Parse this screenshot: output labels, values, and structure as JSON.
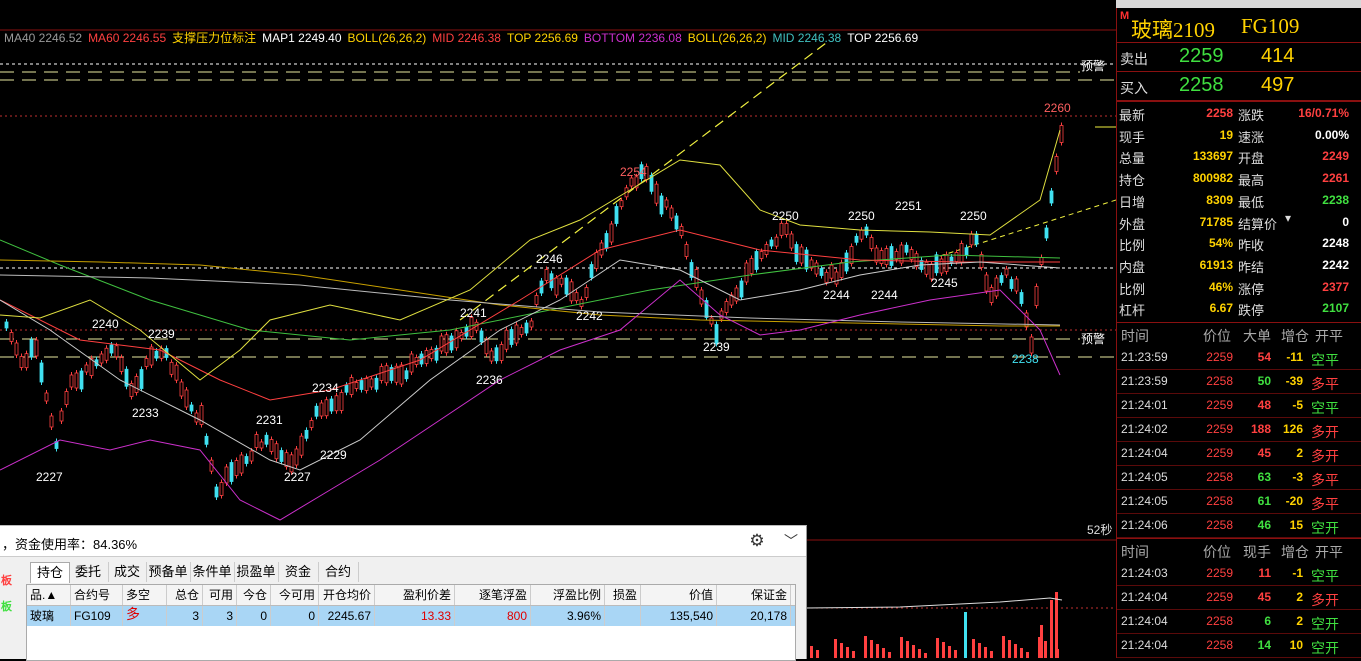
{
  "indicators": [
    {
      "text": "MA40 2246.52",
      "color": "#9a9a9a"
    },
    {
      "text": "MA60 2246.55",
      "color": "#ff4040"
    },
    {
      "text": "支撑压力位标注",
      "color": "#ffd200"
    },
    {
      "text": "MAP1 2249.40",
      "color": "#ffffff"
    },
    {
      "text": "BOLL(26,26,2)",
      "color": "#ffd200"
    },
    {
      "text": "MID 2246.38",
      "color": "#ff4040"
    },
    {
      "text": "TOP 2256.69",
      "color": "#ffd200"
    },
    {
      "text": "BOTTOM 2236.08",
      "color": "#cc30cc"
    },
    {
      "text": "BOLL(26,26,2)",
      "color": "#ffd200"
    },
    {
      "text": "MID 2246.38",
      "color": "#40c0c0"
    },
    {
      "text": "TOP 2256.69",
      "color": "#ffffff"
    }
  ],
  "chart_labels": {
    "warn_top": "预警",
    "warn_bottom": "预警",
    "seconds": "52秒",
    "peaks": [
      "2260",
      "2254",
      "2250",
      "2250",
      "2251",
      "2250",
      "2246",
      "2241",
      "2240",
      "2239",
      "2242",
      "2239",
      "2244",
      "2244",
      "2245",
      "2238",
      "2236",
      "2234",
      "2233",
      "2231",
      "2229",
      "2227",
      "2227"
    ]
  },
  "chart_data": {
    "type": "candlestick",
    "y_axis_values": [
      2227,
      2229,
      2231,
      2233,
      2234,
      2236,
      2238,
      2239,
      2240,
      2241,
      2242,
      2244,
      2245,
      2246,
      2250,
      2251,
      2254,
      2260
    ],
    "last_price": 2258
  },
  "panel": {
    "m_mark": "M",
    "name": "玻璃2109",
    "code": "FG109",
    "sell_label": "卖出",
    "sell_price": "2259",
    "sell_vol": "414",
    "buy_label": "买入",
    "buy_price": "2258",
    "buy_vol": "497",
    "quotes": [
      {
        "l1": "最新",
        "v1": "2258",
        "c1": "red",
        "l2": "涨跌",
        "v2": "16/0.71%",
        "c2": "red"
      },
      {
        "l1": "现手",
        "v1": "19",
        "c1": "yellow",
        "l2": "速涨",
        "v2": "0.00%",
        "c2": "white"
      },
      {
        "l1": "总量",
        "v1": "133697",
        "c1": "yellow",
        "l2": "开盘",
        "v2": "2249",
        "c2": "red"
      },
      {
        "l1": "持仓",
        "v1": "800982",
        "c1": "yellow",
        "l2": "最高",
        "v2": "2261",
        "c2": "red"
      },
      {
        "l1": "日增",
        "v1": "8309",
        "c1": "yellow",
        "l2": "最低",
        "v2": "2238",
        "c2": "green"
      },
      {
        "l1": "外盘",
        "v1": "71785",
        "c1": "yellow",
        "l2": "结算价",
        "v2": "0",
        "c2": "white"
      },
      {
        "l1": "比例",
        "v1": "54%",
        "c1": "yellow",
        "l2": "昨收",
        "v2": "2248",
        "c2": "white"
      },
      {
        "l1": "内盘",
        "v1": "61913",
        "c1": "yellow",
        "l2": "昨结",
        "v2": "2242",
        "c2": "white"
      },
      {
        "l1": "比例",
        "v1": "46%",
        "c1": "yellow",
        "l2": "涨停",
        "v2": "2377",
        "c2": "red"
      },
      {
        "l1": "杠杆",
        "v1": "6.67",
        "c1": "yellow",
        "l2": "跌停",
        "v2": "2107",
        "c2": "green"
      }
    ],
    "ticks_header": [
      "时间",
      "价位",
      "大单",
      "增仓",
      "开平"
    ],
    "ticks": [
      {
        "t": "21:23:59",
        "p": "2259",
        "pc": "red",
        "v": "54",
        "vc": "red",
        "c": "-11",
        "cc": "yellow",
        "ty": "空平",
        "tc": "green"
      },
      {
        "t": "21:23:59",
        "p": "2258",
        "pc": "red",
        "v": "50",
        "vc": "green",
        "c": "-39",
        "cc": "yellow",
        "ty": "多平",
        "tc": "red"
      },
      {
        "t": "21:24:01",
        "p": "2259",
        "pc": "red",
        "v": "48",
        "vc": "red",
        "c": "-5",
        "cc": "yellow",
        "ty": "空平",
        "tc": "green"
      },
      {
        "t": "21:24:02",
        "p": "2259",
        "pc": "red",
        "v": "188",
        "vc": "red",
        "c": "126",
        "cc": "yellow",
        "ty": "多开",
        "tc": "red"
      },
      {
        "t": "21:24:04",
        "p": "2259",
        "pc": "red",
        "v": "45",
        "vc": "red",
        "c": "2",
        "cc": "yellow",
        "ty": "多开",
        "tc": "red"
      },
      {
        "t": "21:24:05",
        "p": "2258",
        "pc": "red",
        "v": "63",
        "vc": "green",
        "c": "-3",
        "cc": "yellow",
        "ty": "多平",
        "tc": "red"
      },
      {
        "t": "21:24:05",
        "p": "2258",
        "pc": "red",
        "v": "61",
        "vc": "green",
        "c": "-20",
        "cc": "yellow",
        "ty": "多平",
        "tc": "red"
      },
      {
        "t": "21:24:06",
        "p": "2258",
        "pc": "red",
        "v": "46",
        "vc": "green",
        "c": "15",
        "cc": "yellow",
        "ty": "空开",
        "tc": "green"
      }
    ],
    "ticks2_header": [
      "时间",
      "价位",
      "现手",
      "增仓",
      "开平"
    ],
    "ticks2": [
      {
        "t": "21:24:03",
        "p": "2259",
        "pc": "red",
        "v": "11",
        "vc": "red",
        "c": "-1",
        "cc": "yellow",
        "ty": "空平",
        "tc": "green"
      },
      {
        "t": "21:24:04",
        "p": "2259",
        "pc": "red",
        "v": "45",
        "vc": "red",
        "c": "2",
        "cc": "yellow",
        "ty": "多开",
        "tc": "red"
      },
      {
        "t": "21:24:04",
        "p": "2258",
        "pc": "red",
        "v": "6",
        "vc": "green",
        "c": "2",
        "cc": "yellow",
        "ty": "空开",
        "tc": "green"
      },
      {
        "t": "21:24:04",
        "p": "2258",
        "pc": "red",
        "v": "14",
        "vc": "green",
        "c": "10",
        "cc": "yellow",
        "ty": "空开",
        "tc": "green"
      }
    ]
  },
  "positions": {
    "header": "，资金使用率：84.36%",
    "side_tag_1": "板",
    "side_tag_2": "板",
    "tabs": [
      "持仓",
      "委托",
      "成交",
      "预备单",
      "条件单",
      "损盈单",
      "资金",
      "合约"
    ],
    "columns": [
      "品.▲",
      "合约号",
      "多空",
      "总仓",
      "可用",
      "今仓",
      "今可用",
      "开仓均价",
      "盈利价差",
      "逐笔浮盈",
      "浮盈比例",
      "损盈",
      "价值",
      "保证金"
    ],
    "row": [
      "玻璃",
      "FG109",
      "多",
      "3",
      "3",
      "0",
      "0",
      "2245.67",
      "13.33",
      "800",
      "3.96%",
      "",
      "135,540",
      "20,178"
    ]
  }
}
